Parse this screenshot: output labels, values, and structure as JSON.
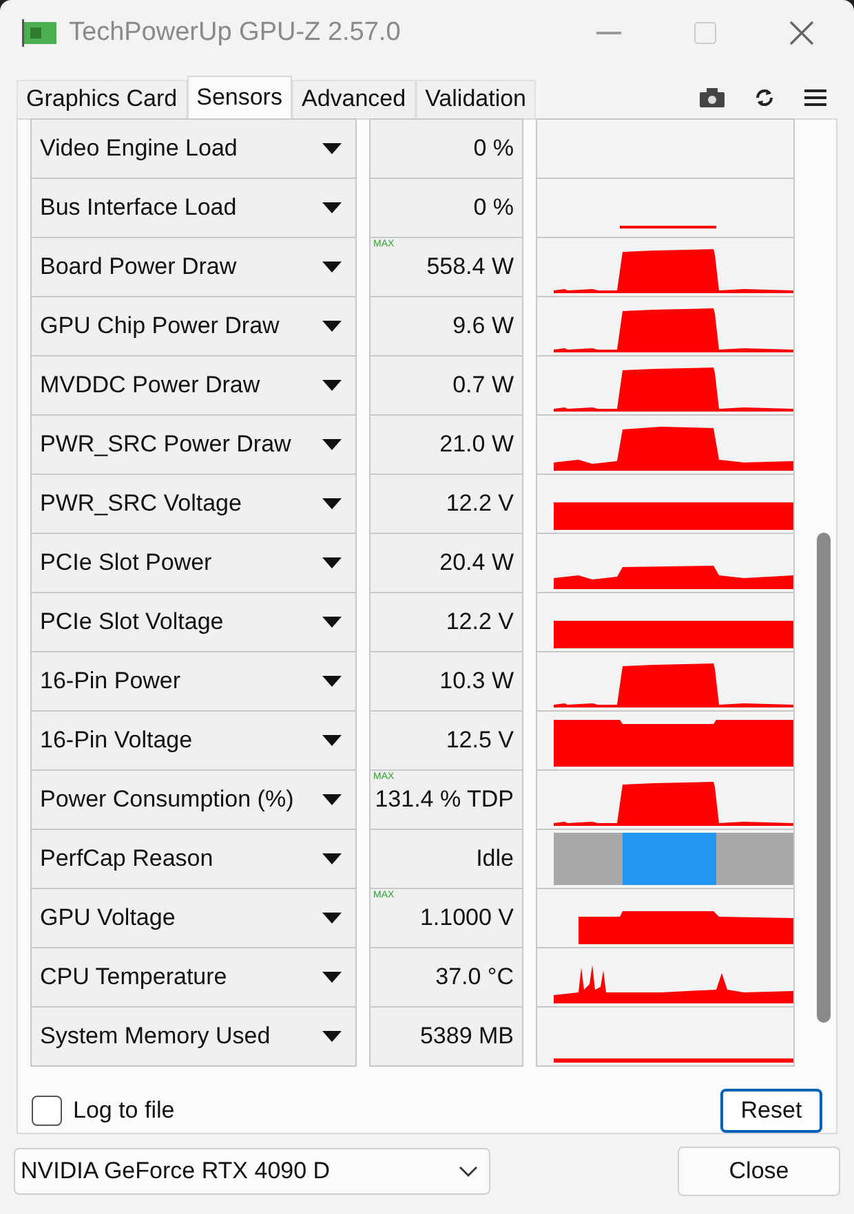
{
  "window": {
    "title": "TechPowerUp GPU-Z 2.57.0"
  },
  "tabs": [
    {
      "label": "Graphics Card",
      "selected": false
    },
    {
      "label": "Sensors",
      "selected": true
    },
    {
      "label": "Advanced",
      "selected": false
    },
    {
      "label": "Validation",
      "selected": false
    }
  ],
  "sensors": [
    {
      "name": "Video Engine Load",
      "value": "0 %",
      "kind": "empty"
    },
    {
      "name": "Bus Interface Load",
      "value": "0 %",
      "kind": "bump"
    },
    {
      "name": "Board Power Draw",
      "value": "558.4 W",
      "mode": "MAX",
      "kind": "plateau"
    },
    {
      "name": "GPU Chip Power Draw",
      "value": "9.6 W",
      "kind": "plateau"
    },
    {
      "name": "MVDDC Power Draw",
      "value": "0.7 W",
      "kind": "plateau"
    },
    {
      "name": "PWR_SRC Power Draw",
      "value": "21.0 W",
      "kind": "raised"
    },
    {
      "name": "PWR_SRC Voltage",
      "value": "12.2 V",
      "kind": "full"
    },
    {
      "name": "PCIe Slot Power",
      "value": "20.4 W",
      "kind": "low"
    },
    {
      "name": "PCIe Slot Voltage",
      "value": "12.2 V",
      "kind": "full"
    },
    {
      "name": "16-Pin Power",
      "value": "10.3 W",
      "kind": "plateau"
    },
    {
      "name": "16-Pin Voltage",
      "value": "12.5 V",
      "kind": "dip"
    },
    {
      "name": "Power Consumption (%)",
      "value": "131.4 % TDP",
      "mode": "MAX",
      "kind": "plateau"
    },
    {
      "name": "PerfCap Reason",
      "value": "Idle",
      "kind": "perfcap"
    },
    {
      "name": "GPU Voltage",
      "value": "1.1000 V",
      "mode": "MAX",
      "kind": "mid"
    },
    {
      "name": "CPU Temperature",
      "value": "37.0 °C",
      "kind": "spikes"
    },
    {
      "name": "System Memory Used",
      "value": "5389 MB",
      "kind": "line"
    }
  ],
  "log_to_file": {
    "label": "Log to file",
    "checked": false
  },
  "reset_button": "Reset",
  "device_select": {
    "value": "NVIDIA GeForce RTX 4090 D"
  },
  "close_button": "Close"
}
